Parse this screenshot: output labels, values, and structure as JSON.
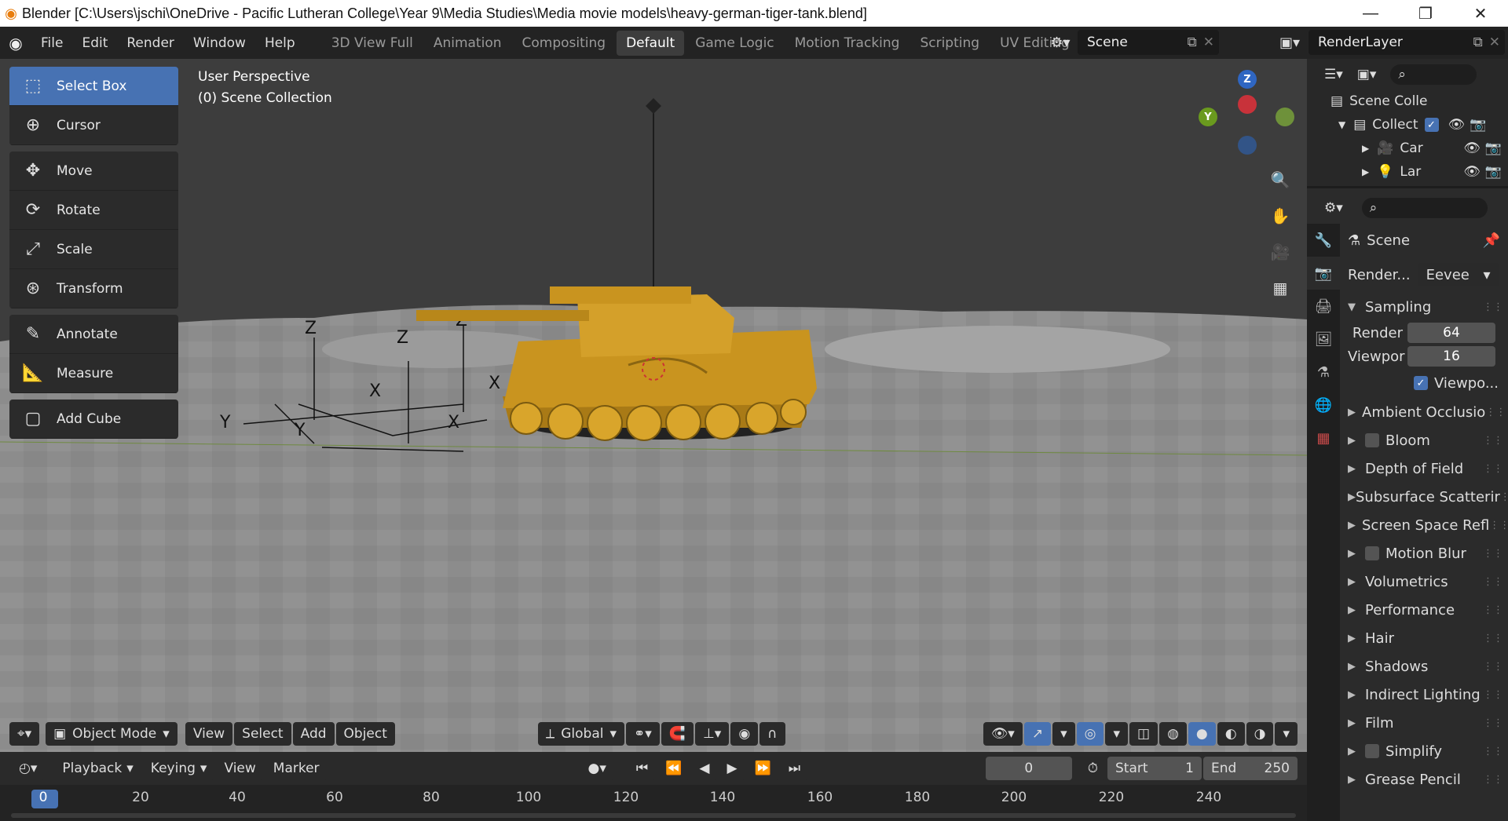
{
  "window": {
    "title": "Blender [C:\\Users\\jschi\\OneDrive - Pacific Lutheran College\\Year 9\\Media Studies\\Media movie models\\heavy-german-tiger-tank.blend]"
  },
  "menus": [
    "File",
    "Edit",
    "Render",
    "Window",
    "Help"
  ],
  "workspaces": [
    "3D View Full",
    "Animation",
    "Compositing",
    "Default",
    "Game Logic",
    "Motion Tracking",
    "Scripting",
    "UV Editing"
  ],
  "active_workspace": "Default",
  "scene_name": "Scene",
  "view_layer": "RenderLayer",
  "toolbar": [
    "Select Box",
    "Cursor",
    "Move",
    "Rotate",
    "Scale",
    "Transform",
    "Annotate",
    "Measure",
    "Add Cube"
  ],
  "viewport": {
    "perspective": "User Perspective",
    "collection": "(0) Scene Collection",
    "gizmo": {
      "z": "Z",
      "y": "Y"
    }
  },
  "vp_header": {
    "mode": "Object Mode",
    "menus": [
      "View",
      "Select",
      "Add",
      "Object"
    ],
    "orientation": "Global"
  },
  "timeline": {
    "menus": [
      "Playback",
      "Keying",
      "View",
      "Marker"
    ],
    "current_frame": "0",
    "start_label": "Start",
    "start": "1",
    "end_label": "End",
    "end": "250",
    "ruler": [
      "0",
      "20",
      "40",
      "60",
      "80",
      "100",
      "120",
      "140",
      "160",
      "180",
      "200",
      "220",
      "240"
    ]
  },
  "outliner": {
    "root": "Scene Colle",
    "collection": "Collect",
    "items": [
      "Car",
      "Lar"
    ]
  },
  "properties": {
    "context": "Scene",
    "render_engine_label": "Render...",
    "render_engine": "Eevee",
    "sampling": "Sampling",
    "render_label": "Render",
    "render_samples": "64",
    "viewport_label": "Viewpor",
    "viewport_samples": "16",
    "viewport_denoise": "Viewpo...",
    "panels": [
      {
        "label": "Ambient Occlusio",
        "checkbox": true
      },
      {
        "label": "Bloom",
        "checkbox": true
      },
      {
        "label": "Depth of Field",
        "checkbox": false
      },
      {
        "label": "Subsurface Scatterir",
        "checkbox": false
      },
      {
        "label": "Screen Space Refl",
        "checkbox": true
      },
      {
        "label": "Motion Blur",
        "checkbox": true
      },
      {
        "label": "Volumetrics",
        "checkbox": false
      },
      {
        "label": "Performance",
        "checkbox": false
      },
      {
        "label": "Hair",
        "checkbox": false
      },
      {
        "label": "Shadows",
        "checkbox": false
      },
      {
        "label": "Indirect Lighting",
        "checkbox": false
      },
      {
        "label": "Film",
        "checkbox": false
      },
      {
        "label": "Simplify",
        "checkbox": true
      },
      {
        "label": "Grease Pencil",
        "checkbox": false
      }
    ]
  },
  "colors": {
    "accent": "#4772b3",
    "tank": "#c9941f",
    "viewport": "#3d3d3d"
  }
}
